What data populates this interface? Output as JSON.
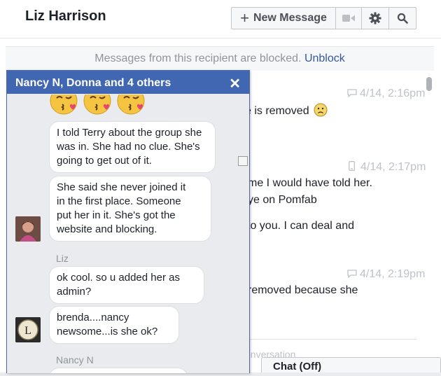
{
  "header": {
    "title": "Liz Harrison",
    "new_message_label": "New Message"
  },
  "blocked_notice": {
    "text": "Messages from this recipient are blocked.",
    "link": "Unblock"
  },
  "main_thread": {
    "timestamps": [
      "4/14, 2:16pm",
      "4/14, 2:17pm",
      "4/14, 2:19pm"
    ],
    "fragments": [
      "e is removed",
      "me I would have told her.",
      "ye on Pomfab",
      "to you. I can deal and",
      "removed because she"
    ],
    "compose_hint": "onversation"
  },
  "chatbar": {
    "label": "Chat (Off)"
  },
  "chat": {
    "title": "Nancy N, Donna and 4 others",
    "close_label": "✕",
    "messages": [
      {
        "lines": [
          "I told Terry about the group she",
          "was in. She had no clue. She's",
          "going to get out of it."
        ]
      },
      {
        "lines": [
          "She said she never joined it",
          "in the first place. Someone",
          "put her in it. She's got the",
          "website and blocking."
        ]
      },
      {
        "sender": "Liz"
      },
      {
        "lines": [
          "ok cool. so u added her as",
          "admin?"
        ]
      },
      {
        "lines": [
          "brenda....nancy",
          "newsome...is she ok?"
        ]
      },
      {
        "sender": "Nancy N"
      }
    ],
    "avatar_initial": "L"
  },
  "colors": {
    "header_blue": "#4267b2",
    "link_blue": "#365899"
  }
}
